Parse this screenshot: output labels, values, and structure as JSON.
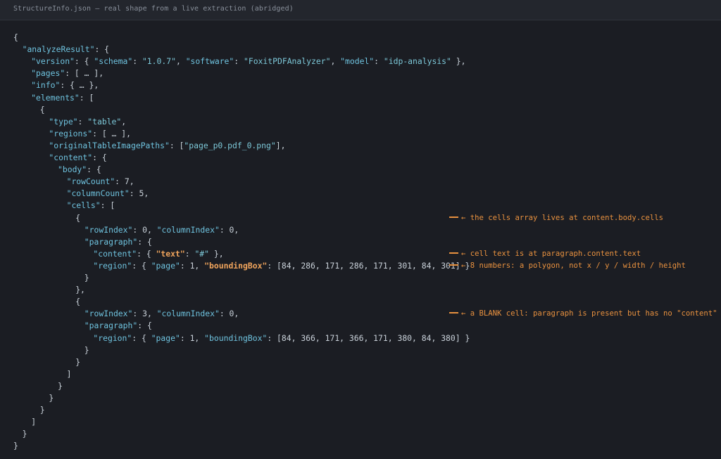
{
  "window": {
    "title": "StructureInfo.json — real shape from a live extraction (abridged)"
  },
  "code_lines": [
    {
      "indent": 0,
      "tokens": [
        {
          "t": "p",
          "v": "{"
        }
      ]
    },
    {
      "indent": 1,
      "tokens": [
        {
          "t": "k",
          "v": "\"analyzeResult\""
        },
        {
          "t": "p",
          "v": ": {"
        }
      ]
    },
    {
      "indent": 2,
      "tokens": [
        {
          "t": "k",
          "v": "\"version\""
        },
        {
          "t": "p",
          "v": ": { "
        },
        {
          "t": "k",
          "v": "\"schema\""
        },
        {
          "t": "p",
          "v": ": "
        },
        {
          "t": "s",
          "v": "\"1.0.7\""
        },
        {
          "t": "p",
          "v": ", "
        },
        {
          "t": "k",
          "v": "\"software\""
        },
        {
          "t": "p",
          "v": ": "
        },
        {
          "t": "s",
          "v": "\"FoxitPDFAnalyzer\""
        },
        {
          "t": "p",
          "v": ", "
        },
        {
          "t": "k",
          "v": "\"model\""
        },
        {
          "t": "p",
          "v": ": "
        },
        {
          "t": "s",
          "v": "\"idp-analysis\""
        },
        {
          "t": "p",
          "v": " },"
        }
      ]
    },
    {
      "indent": 2,
      "tokens": [
        {
          "t": "k",
          "v": "\"pages\""
        },
        {
          "t": "p",
          "v": ": [ … ],"
        }
      ]
    },
    {
      "indent": 2,
      "tokens": [
        {
          "t": "k",
          "v": "\"info\""
        },
        {
          "t": "p",
          "v": ": { … },"
        }
      ]
    },
    {
      "indent": 2,
      "tokens": [
        {
          "t": "k",
          "v": "\"elements\""
        },
        {
          "t": "p",
          "v": ": ["
        }
      ]
    },
    {
      "indent": 3,
      "tokens": [
        {
          "t": "p",
          "v": "{"
        }
      ]
    },
    {
      "indent": 4,
      "tokens": [
        {
          "t": "k",
          "v": "\"type\""
        },
        {
          "t": "p",
          "v": ": "
        },
        {
          "t": "s",
          "v": "\"table\""
        },
        {
          "t": "p",
          "v": ","
        }
      ]
    },
    {
      "indent": 4,
      "tokens": [
        {
          "t": "k",
          "v": "\"regions\""
        },
        {
          "t": "p",
          "v": ": [ … ],"
        }
      ]
    },
    {
      "indent": 4,
      "tokens": [
        {
          "t": "k",
          "v": "\"originalTableImagePaths\""
        },
        {
          "t": "p",
          "v": ": ["
        },
        {
          "t": "s",
          "v": "\"page_p0.pdf_0.png\""
        },
        {
          "t": "p",
          "v": "],"
        }
      ]
    },
    {
      "indent": 4,
      "tokens": [
        {
          "t": "k",
          "v": "\"content\""
        },
        {
          "t": "p",
          "v": ": {"
        }
      ]
    },
    {
      "indent": 5,
      "tokens": [
        {
          "t": "k",
          "v": "\"body\""
        },
        {
          "t": "p",
          "v": ": {"
        }
      ]
    },
    {
      "indent": 6,
      "tokens": [
        {
          "t": "k",
          "v": "\"rowCount\""
        },
        {
          "t": "p",
          "v": ": 7,"
        }
      ]
    },
    {
      "indent": 6,
      "tokens": [
        {
          "t": "k",
          "v": "\"columnCount\""
        },
        {
          "t": "p",
          "v": ": 5,"
        }
      ]
    },
    {
      "indent": 6,
      "tokens": [
        {
          "t": "k",
          "v": "\"cells\""
        },
        {
          "t": "p",
          "v": ": ["
        }
      ]
    },
    {
      "indent": 7,
      "tokens": [
        {
          "t": "p",
          "v": "{"
        }
      ],
      "annotation": "← the cells array lives at content.body.cells"
    },
    {
      "indent": 8,
      "tokens": [
        {
          "t": "k",
          "v": "\"rowIndex\""
        },
        {
          "t": "p",
          "v": ": 0, "
        },
        {
          "t": "k",
          "v": "\"columnIndex\""
        },
        {
          "t": "p",
          "v": ": 0,"
        }
      ]
    },
    {
      "indent": 8,
      "tokens": [
        {
          "t": "k",
          "v": "\"paragraph\""
        },
        {
          "t": "p",
          "v": ": {"
        }
      ]
    },
    {
      "indent": 9,
      "tokens": [
        {
          "t": "k",
          "v": "\"content\""
        },
        {
          "t": "p",
          "v": ": { "
        },
        {
          "t": "hk",
          "v": "\"text\""
        },
        {
          "t": "p",
          "v": ": "
        },
        {
          "t": "s",
          "v": "\"#\""
        },
        {
          "t": "p",
          "v": " },"
        }
      ],
      "annotation": "← cell text is at paragraph.content.text"
    },
    {
      "indent": 9,
      "tokens": [
        {
          "t": "k",
          "v": "\"region\""
        },
        {
          "t": "p",
          "v": ": { "
        },
        {
          "t": "k",
          "v": "\"page\""
        },
        {
          "t": "p",
          "v": ": 1, "
        },
        {
          "t": "hk",
          "v": "\"boundingBox\""
        },
        {
          "t": "p",
          "v": ": [84, 286, 171, 286, 171, 301, 84, 301] }"
        }
      ],
      "annotation": "← 8 numbers: a polygon, not x / y / width / height"
    },
    {
      "indent": 8,
      "tokens": [
        {
          "t": "p",
          "v": "}"
        }
      ]
    },
    {
      "indent": 7,
      "tokens": [
        {
          "t": "p",
          "v": "},"
        }
      ]
    },
    {
      "indent": 7,
      "tokens": [
        {
          "t": "p",
          "v": "{"
        }
      ]
    },
    {
      "indent": 8,
      "tokens": [
        {
          "t": "k",
          "v": "\"rowIndex\""
        },
        {
          "t": "p",
          "v": ": 3, "
        },
        {
          "t": "k",
          "v": "\"columnIndex\""
        },
        {
          "t": "p",
          "v": ": 0,"
        }
      ],
      "annotation": "← a BLANK cell: paragraph is present but has no \"content\" key"
    },
    {
      "indent": 8,
      "tokens": [
        {
          "t": "k",
          "v": "\"paragraph\""
        },
        {
          "t": "p",
          "v": ": {"
        }
      ]
    },
    {
      "indent": 9,
      "tokens": [
        {
          "t": "k",
          "v": "\"region\""
        },
        {
          "t": "p",
          "v": ": { "
        },
        {
          "t": "k",
          "v": "\"page\""
        },
        {
          "t": "p",
          "v": ": 1, "
        },
        {
          "t": "k",
          "v": "\"boundingBox\""
        },
        {
          "t": "p",
          "v": ": [84, 366, 171, 366, 171, 380, 84, 380] }"
        }
      ]
    },
    {
      "indent": 8,
      "tokens": [
        {
          "t": "p",
          "v": "}"
        }
      ]
    },
    {
      "indent": 7,
      "tokens": [
        {
          "t": "p",
          "v": "}"
        }
      ]
    },
    {
      "indent": 6,
      "tokens": [
        {
          "t": "p",
          "v": "]"
        }
      ]
    },
    {
      "indent": 5,
      "tokens": [
        {
          "t": "p",
          "v": "}"
        }
      ]
    },
    {
      "indent": 4,
      "tokens": [
        {
          "t": "p",
          "v": "}"
        }
      ]
    },
    {
      "indent": 3,
      "tokens": [
        {
          "t": "p",
          "v": "}"
        }
      ]
    },
    {
      "indent": 2,
      "tokens": [
        {
          "t": "p",
          "v": "]"
        }
      ]
    },
    {
      "indent": 1,
      "tokens": [
        {
          "t": "p",
          "v": "}"
        }
      ]
    },
    {
      "indent": 0,
      "tokens": [
        {
          "t": "p",
          "v": "}"
        }
      ]
    }
  ],
  "colors": {
    "background": "#1b1d23",
    "key": "#6fc3df",
    "highlight_key": "#f0a45c",
    "annotation": "#e8913f"
  }
}
